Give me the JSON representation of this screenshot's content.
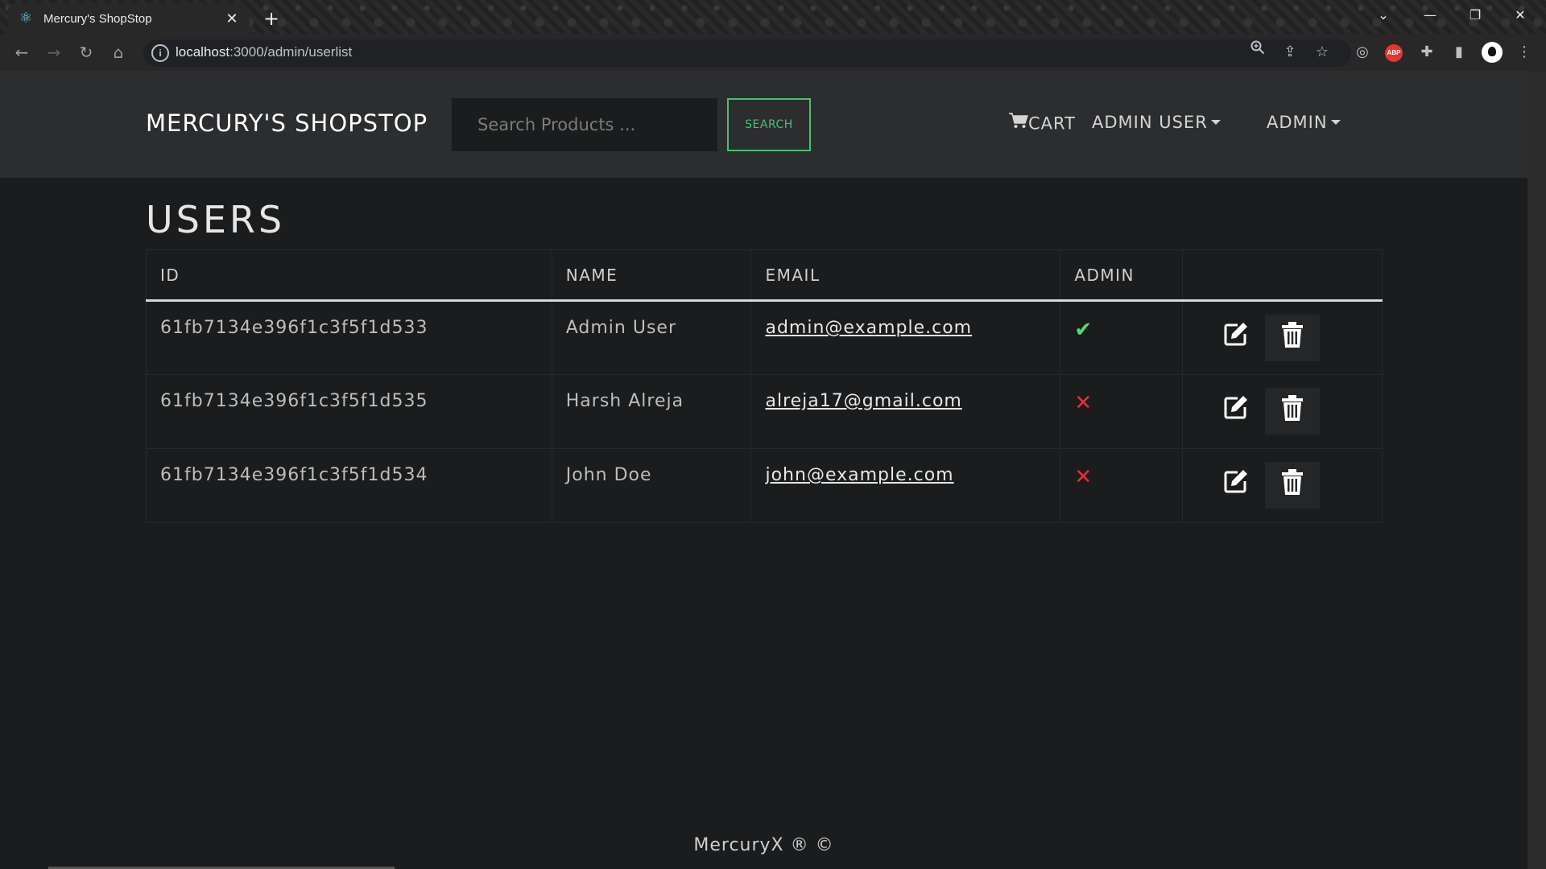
{
  "browser": {
    "tab_title": "Mercury's ShopStop",
    "url_host": "localhost",
    "url_path": ":3000/admin/userlist"
  },
  "navbar": {
    "brand": "MERCURY'S SHOPSTOP",
    "search_placeholder": "Search Products ...",
    "search_button": "SEARCH",
    "cart_label": "CART",
    "user_menu": "ADMIN USER",
    "admin_menu": "ADMIN"
  },
  "page": {
    "title": "USERS"
  },
  "table": {
    "headers": [
      "ID",
      "NAME",
      "EMAIL",
      "ADMIN",
      ""
    ],
    "rows": [
      {
        "id": "61fb7134e396f1c3f5f1d533",
        "name": "Admin User",
        "email": "admin@example.com",
        "is_admin": true
      },
      {
        "id": "61fb7134e396f1c3f5f1d535",
        "name": "Harsh Alreja",
        "email": "alreja17@gmail.com",
        "is_admin": false
      },
      {
        "id": "61fb7134e396f1c3f5f1d534",
        "name": "John Doe",
        "email": "john@example.com",
        "is_admin": false
      }
    ]
  },
  "footer": {
    "text": "MercuryX ® ©"
  },
  "colors": {
    "accent_green": "#4bbf73",
    "admin_yes": "#4bdf73",
    "admin_no": "#e8312a",
    "navbar_bg": "#2b2d2f",
    "page_bg": "#1b1c1d"
  },
  "icons": {
    "yes": "check-icon",
    "no": "x-icon",
    "edit": "edit-icon",
    "delete": "trash-icon",
    "cart": "cart-icon"
  }
}
